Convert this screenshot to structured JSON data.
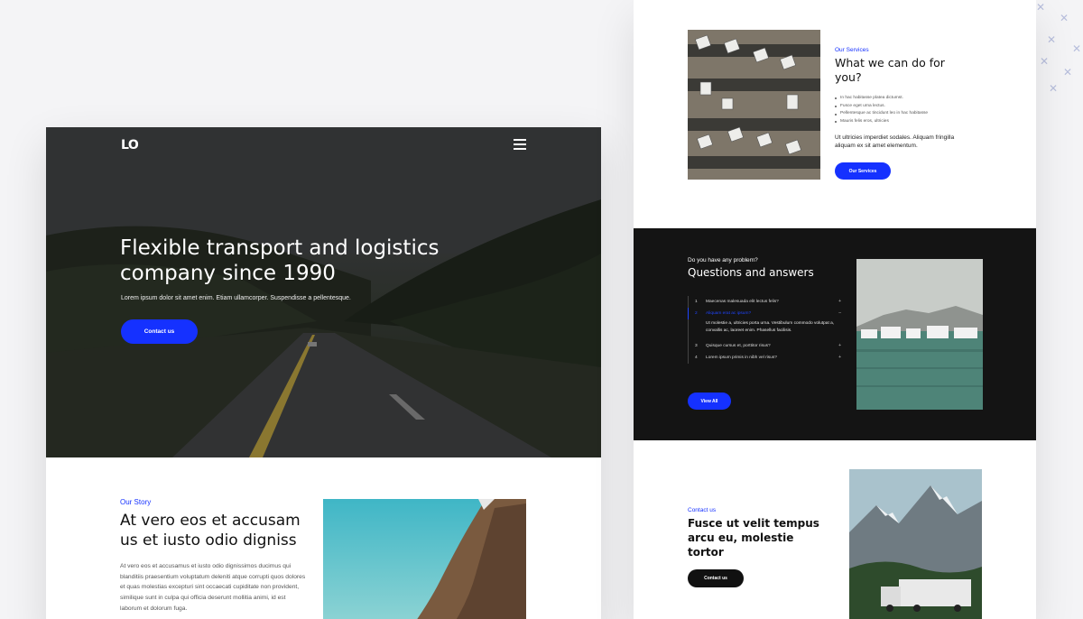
{
  "hero": {
    "logo": "LO",
    "title": "Flexible transport and logistics company since 1990",
    "subtitle": "Lorem ipsum dolor sit amet enim. Etiam ullamcorper. Suspendisse a pellentesque.",
    "cta": "Contact us"
  },
  "story": {
    "eyebrow": "Our Story",
    "title": "At vero eos et accusam us et iusto odio digniss",
    "body": "At vero eos et accusamus et iusto odio dignissimos ducimus qui blanditiis praesentium voluptatum deleniti atque corrupti quos dolores et quas molestias excepturi sint occaecati cupiditate non provident, similique sunt in culpa qui officia deserunt mollitia animi, id est laborum et dolorum fuga."
  },
  "services": {
    "eyebrow": "Our Services",
    "title": "What we can do for you?",
    "list": [
      "In hac habitasse platea dictumst.",
      "Fusce eget urna lectus.",
      "Pellentesque ac tincidunt leo in hac habitasse",
      "Mauris felis eros, ultricies"
    ],
    "paragraph": "Ut ultricies imperdiet sodales. Aliquam fringilla aliquam ex sit amet elementum.",
    "button": "Our Services"
  },
  "faq": {
    "eyebrow": "Do you have any problem?",
    "title": "Questions and answers",
    "items": [
      {
        "num": "1",
        "question": "Maecenas malesuada elit lectus felis?"
      },
      {
        "num": "2",
        "question": "Aliquam erat ac ipsum?"
      },
      {
        "num": "3",
        "question": "Quisque cursus et, porttitor risus?"
      },
      {
        "num": "4",
        "question": "Lorem ipsum primis in nibh vel risus?"
      }
    ],
    "answer": "Ut molestie a, ultricies porta urna. Vestibulum commodo volutpat a, convallis ac, laoreet enim. Phasellus facilisis.",
    "button": "View All"
  },
  "contact": {
    "eyebrow": "Contact us",
    "title": "Fusce ut velit tempus arcu eu, molestie tortor",
    "button": "Contact us"
  },
  "colors": {
    "accent": "#1531ff",
    "dark_section": "#141414"
  },
  "icons": {
    "menu": "hamburger-menu-icon",
    "faq_expand": "plus-icon",
    "faq_collapse": "minus-icon",
    "decor": "star-icon"
  }
}
